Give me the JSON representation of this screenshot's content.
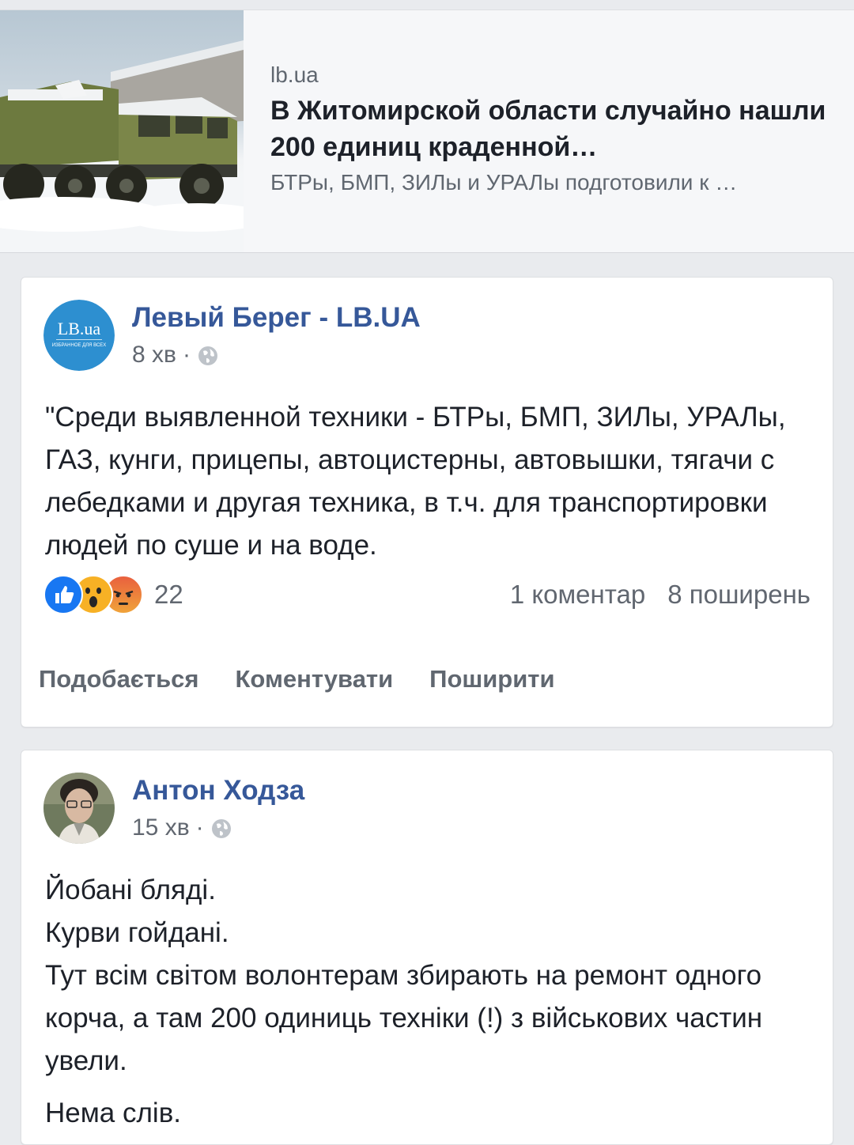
{
  "link": {
    "domain": "lb.ua",
    "title": "В Житомирской области случайно нашли 200 единиц краденной…",
    "description": "БТРы, БМП, ЗИЛы и УРАЛы подготовили к …",
    "image": "military-truck-in-snow"
  },
  "posts": [
    {
      "author": "Левый Берег - LB.UA",
      "time": "8 хв",
      "separator": "·",
      "privacy_icon": "globe-icon",
      "avatar_text": "LB.ua",
      "avatar_subtext": "избранное для всех",
      "text": "\"Среди выявленной техники - БТРы, БМП, ЗИЛы, УРАЛы, ГАЗ, кунги, прицепы, автоцистерны, автовышки, тягачи с лебедками и другая техника, в т.ч. для транспортировки людей по суше и на воде.",
      "reactions": {
        "icons": [
          "like-icon",
          "wow-icon",
          "angry-icon"
        ],
        "count": "22"
      },
      "comments": "1 коментар",
      "shares": "8 поширень",
      "actions": {
        "like": "Подобається",
        "comment": "Коментувати",
        "share": "Поширити"
      }
    },
    {
      "author": "Антон Ходза",
      "time": "15 хв",
      "separator": "·",
      "privacy_icon": "globe-icon",
      "lines": [
        "Йобані бляді.",
        "Курви гойдані.",
        "Тут всім світом волонтерам збирають на ремонт одного корча, а там 200 одиниць техніки (!) з військових частин увели.",
        "Нема слів."
      ]
    }
  ],
  "colors": {
    "background": "#e9ebee",
    "author_link": "#365899",
    "text": "#1d2129",
    "secondary": "#616770",
    "like_blue": "#1877f2"
  }
}
